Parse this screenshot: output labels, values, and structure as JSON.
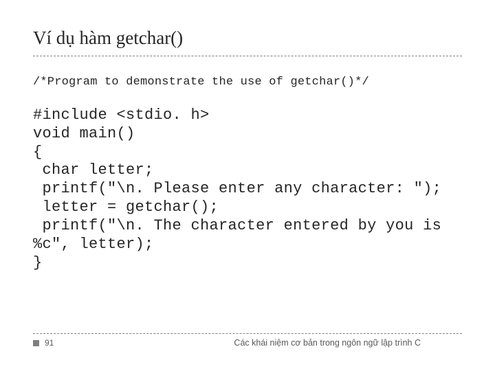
{
  "title": "Ví dụ hàm getchar()",
  "comment": "/*Program to demonstrate the use of getchar()*/",
  "code": "#include <stdio. h>\nvoid main()\n{\n char letter;\n printf(\"\\n. Please enter any character: \");\n letter = getchar();\n printf(\"\\n. The character entered by you is %c\", letter);\n}",
  "footer": {
    "page": "91",
    "text": "Các khái niệm cơ bản trong ngôn ngữ lập trình C"
  }
}
